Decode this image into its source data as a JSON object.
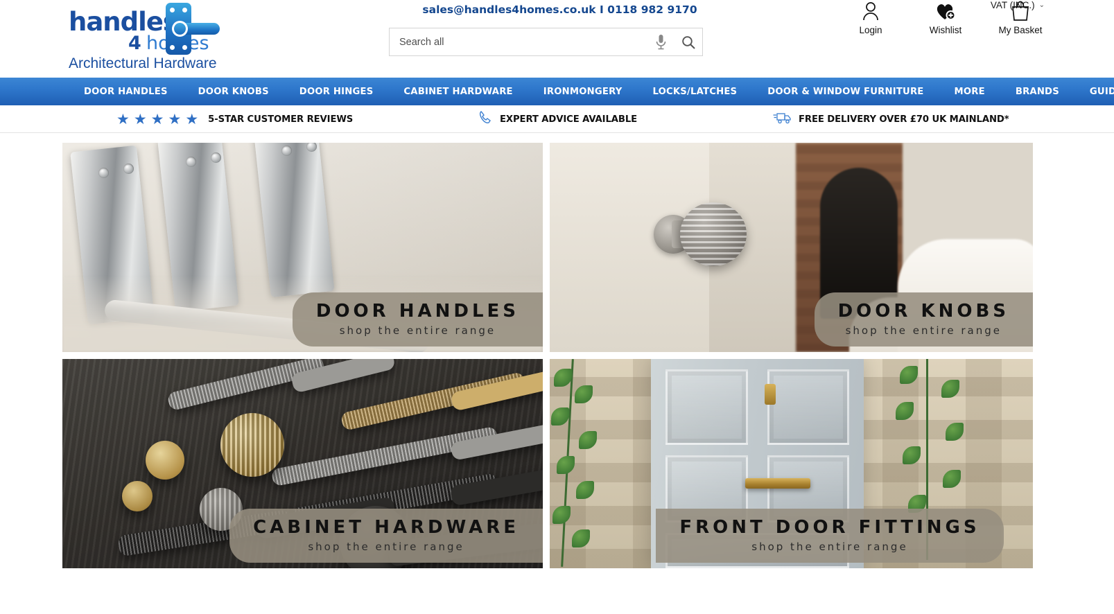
{
  "header": {
    "logo": {
      "word1": "handles",
      "word2": "4",
      "word3": "homes",
      "tagline": "Architectural Hardware"
    },
    "contact": "sales@handles4homes.co.uk I 0118 982 9170",
    "vat_toggle": "VAT (INC.)",
    "search": {
      "placeholder": "Search all",
      "value": "",
      "mic_icon": "microphone-icon",
      "search_icon": "magnifier-icon"
    },
    "account": [
      {
        "label": "Login",
        "icon": "person-icon"
      },
      {
        "label": "Wishlist",
        "icon": "heart-plus-icon"
      },
      {
        "label": "My Basket",
        "icon": "shopping-bag-icon"
      }
    ]
  },
  "nav": {
    "items": [
      {
        "label": "DOOR HANDLES"
      },
      {
        "label": "DOOR KNOBS"
      },
      {
        "label": "DOOR HINGES"
      },
      {
        "label": "CABINET HARDWARE"
      },
      {
        "label": "IRONMONGERY"
      },
      {
        "label": "LOCKS/LATCHES"
      },
      {
        "label": "DOOR & WINDOW FURNITURE"
      },
      {
        "label": "MORE"
      },
      {
        "label": "BRANDS"
      },
      {
        "label": "GUIDES"
      }
    ]
  },
  "usp": {
    "stars": "★★★★★",
    "items": [
      {
        "text": "5-STAR CUSTOMER REVIEWS",
        "icon": "star-rating-icon"
      },
      {
        "text": "EXPERT ADVICE AVAILABLE",
        "icon": "phone-icon"
      },
      {
        "text": "FREE DELIVERY OVER £70 UK MAINLAND*",
        "icon": "delivery-truck-icon"
      }
    ]
  },
  "tiles": [
    {
      "title": "DOOR HANDLES",
      "subtitle": "shop the entire range"
    },
    {
      "title": "DOOR KNOBS",
      "subtitle": "shop the entire range"
    },
    {
      "title": "CABINET HARDWARE",
      "subtitle": "shop the entire range"
    },
    {
      "title": "FRONT DOOR FITTINGS",
      "subtitle": "shop the entire range"
    }
  ],
  "colors": {
    "brand_blue": "#1b4fa0",
    "nav_blue": "#2f78cc",
    "star_blue": "#2f6fc4",
    "badge_grey": "#968e80"
  }
}
